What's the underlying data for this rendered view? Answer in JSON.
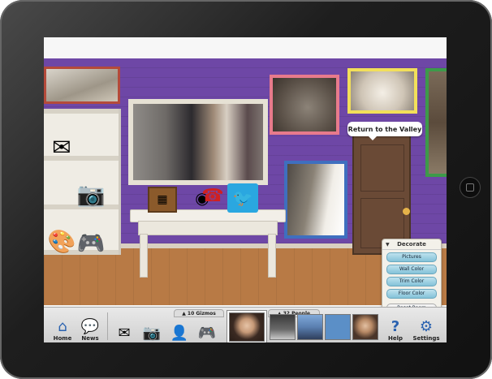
{
  "room": {
    "tooltip": "Return to the Valley"
  },
  "decorate": {
    "title": "Decorate",
    "buttons": [
      "Pictures",
      "Wall Color",
      "Trim Color",
      "Floor Color"
    ],
    "reset": "Reset Room"
  },
  "bottom": {
    "gizmos_label": "10 Gizmos",
    "people_label": "32 People",
    "home": "Home",
    "news": "News",
    "help": "Help",
    "settings": "Settings"
  },
  "icons": {
    "home": "house-icon",
    "news": "speech-bubble-icon",
    "envelope": "envelope-icon",
    "camera": "camera-icon",
    "add_person": "add-person-icon",
    "gamepad": "gamepad-icon",
    "help": "question-mark-icon",
    "settings": "gear-icon",
    "twitter": "twitter-bird-icon",
    "palette": "palette-icon",
    "phone": "red-phone-icon",
    "webcam": "webcam-icon"
  },
  "colors": {
    "wall": "#6e47a6",
    "floor": "#b87a45",
    "frame_pink": "#e87a8c",
    "frame_yellow": "#f2df5a",
    "frame_blue": "#3f6fbf",
    "frame_green": "#3d9a4a",
    "frame_red": "#b44a3a"
  }
}
